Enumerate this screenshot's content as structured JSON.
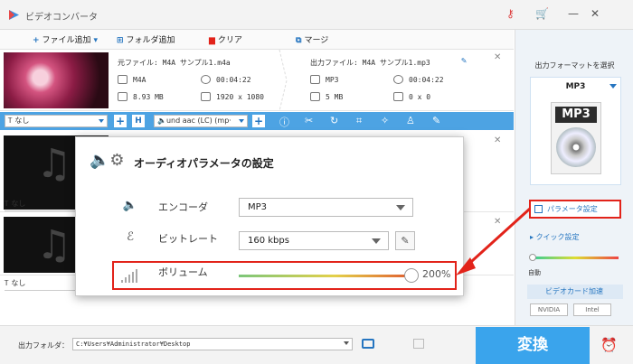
{
  "app": {
    "title": "ビデオコンバータ"
  },
  "toolbar": {
    "add_file": "ファイル追加",
    "add_folder": "フォルダ追加",
    "clear": "クリア",
    "merge": "マージ"
  },
  "files": [
    {
      "source_name": "元ファイル: M4A サンプル1.m4a",
      "output_name": "出力ファイル: M4A サンプル1.mp3",
      "src_format": "M4A",
      "src_duration": "00:04:22",
      "src_size": "8.93 MB",
      "src_resolution": "1920 x 1080",
      "out_format": "MP3",
      "out_duration": "00:04:22",
      "out_size": "5 MB",
      "out_resolution": "0 x 0"
    }
  ],
  "edit_bar": {
    "subtitle_value": "なし",
    "audio_value": "und aac (LC) (mp·"
  },
  "ghost_rows": {
    "subtitle_2": "なし",
    "subtitle_3": "なし"
  },
  "right_panel": {
    "format_title": "出力フォーマットを選択",
    "format_value": "MP3",
    "format_icon_text": "MP3",
    "param_button": "パラメータ設定",
    "quick_settings": "クイック設定",
    "auto_label": "自動",
    "gpu_button": "ビデオカード加速",
    "gpu_logo_1": "NVIDIA",
    "gpu_logo_2": "Intel"
  },
  "dialog": {
    "title": "オーディオパラメータの設定",
    "encoder_label": "エンコーダ",
    "encoder_value": "MP3",
    "bitrate_label": "ビットレート",
    "bitrate_value": "160 kbps",
    "volume_label": "ボリューム",
    "volume_value": "200%",
    "volume_level": 1.0
  },
  "bottom": {
    "output_folder_label": "出力フォルダ：",
    "output_folder_path": "C:¥Users¥Administrator¥Desktop",
    "convert_button": "変換"
  },
  "colors": {
    "accent_blue": "#3aa4ec",
    "edit_bar_blue": "#4da3e3",
    "highlight_red": "#e2231a"
  }
}
